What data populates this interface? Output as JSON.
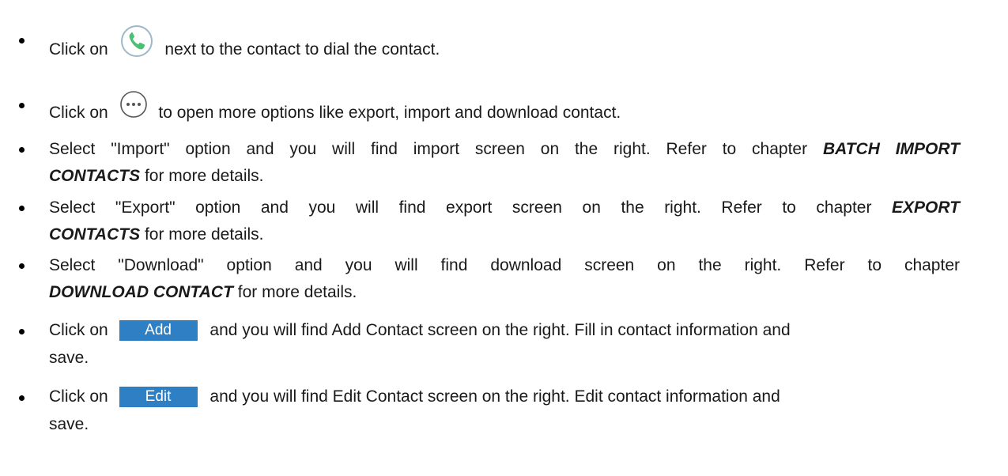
{
  "bullets": {
    "b1": {
      "pre": "Click on",
      "post": "next to the contact to dial the contact.",
      "icon": "phone-icon"
    },
    "b2": {
      "pre": "Click on",
      "post": "to open more options like export, import and download contact.",
      "icon": "more-options-icon"
    },
    "b3": {
      "line1_pre": "Select \"Import\" option and you will find import screen on the right. Refer to chapter",
      "line1_ref": "BATCH IMPORT",
      "line2_ref": "CONTACTS",
      "line2_post": " for more details."
    },
    "b4": {
      "line1_pre": "Select \"Export\" option and you will find export screen on the right. Refer to chapter",
      "line1_ref": "EXPORT",
      "line2_ref": "CONTACTS",
      "line2_post": " for more details."
    },
    "b5": {
      "line1": "Select \"Download\" option and you will find download screen on the right. Refer to chapter",
      "line2_ref": "DOWNLOAD CONTACT",
      "line2_post": " for more details."
    },
    "b6": {
      "pre": "Click on",
      "button": "Add",
      "post": "and you will find Add Contact screen on the right. Fill in contact information and",
      "line2": "save."
    },
    "b7": {
      "pre": "Click on",
      "button": "Edit",
      "post": "and you will find Edit Contact screen on the right. Edit contact information and",
      "line2": "save."
    }
  },
  "colors": {
    "button_bg": "#2f7fc5",
    "phone_green": "#4bbf73",
    "text": "#1a1a1a"
  }
}
